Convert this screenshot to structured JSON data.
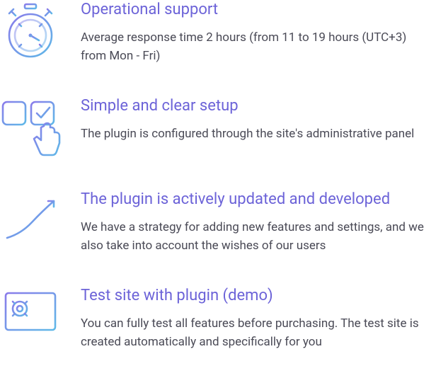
{
  "features": [
    {
      "title": "Operational support",
      "desc": "Average response time 2 hours (from 11 to 19 hours (UTC+3) from Mon - Fri)"
    },
    {
      "title": "Simple and clear setup",
      "desc": "The plugin is configured through the site's administrative panel"
    },
    {
      "title": "The plugin is actively updated and developed",
      "desc": "We have a strategy for adding new features and settings, and we also take into account the wishes of our users"
    },
    {
      "title": "Test site with plugin (demo)",
      "desc": "You can fully test all features before purchasing. The test site is created automatically and specifically for you"
    }
  ]
}
